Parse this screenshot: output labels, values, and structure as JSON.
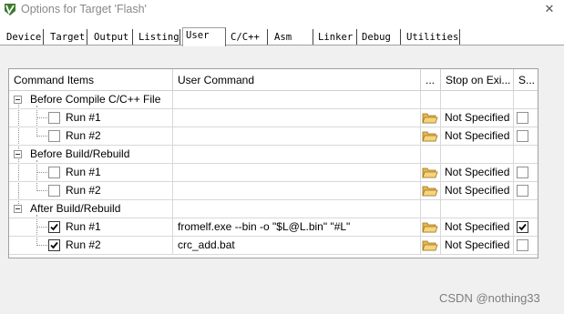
{
  "window": {
    "title": "Options for Target 'Flash'",
    "close_glyph": "✕",
    "icon": "keil-uvision-icon"
  },
  "tabs": [
    {
      "label": "Device"
    },
    {
      "label": "Target"
    },
    {
      "label": "Output"
    },
    {
      "label": "Listing"
    },
    {
      "label": "User"
    },
    {
      "label": "C/C++"
    },
    {
      "label": "Asm"
    },
    {
      "label": "Linker"
    },
    {
      "label": "Debug"
    },
    {
      "label": "Utilities"
    }
  ],
  "active_tab": "User",
  "table": {
    "headers": [
      "Command Items",
      "User Command",
      "...",
      "Stop on Exi...",
      "S..."
    ],
    "groups": [
      {
        "label": "Before Compile C/C++ File",
        "items": [
          {
            "label": "Run #1",
            "checked": false,
            "command": "",
            "stop": "Not Specified",
            "s_checked": false
          },
          {
            "label": "Run #2",
            "checked": false,
            "command": "",
            "stop": "Not Specified",
            "s_checked": false
          }
        ]
      },
      {
        "label": "Before Build/Rebuild",
        "items": [
          {
            "label": "Run #1",
            "checked": false,
            "command": "",
            "stop": "Not Specified",
            "s_checked": false
          },
          {
            "label": "Run #2",
            "checked": false,
            "command": "",
            "stop": "Not Specified",
            "s_checked": false
          }
        ]
      },
      {
        "label": "After Build/Rebuild",
        "items": [
          {
            "label": "Run #1",
            "checked": true,
            "command": "fromelf.exe --bin -o \"$L@L.bin\" \"#L\"",
            "stop": "Not Specified",
            "s_checked": true
          },
          {
            "label": "Run #2",
            "checked": true,
            "command": "crc_add.bat",
            "stop": "Not Specified",
            "s_checked": false
          }
        ]
      }
    ]
  },
  "watermark": "CSDN @nothing33",
  "colors": {
    "grid_border": "#a0a0a0",
    "panel_bg": "#f0f0f0",
    "folder": "#e8b64c"
  }
}
